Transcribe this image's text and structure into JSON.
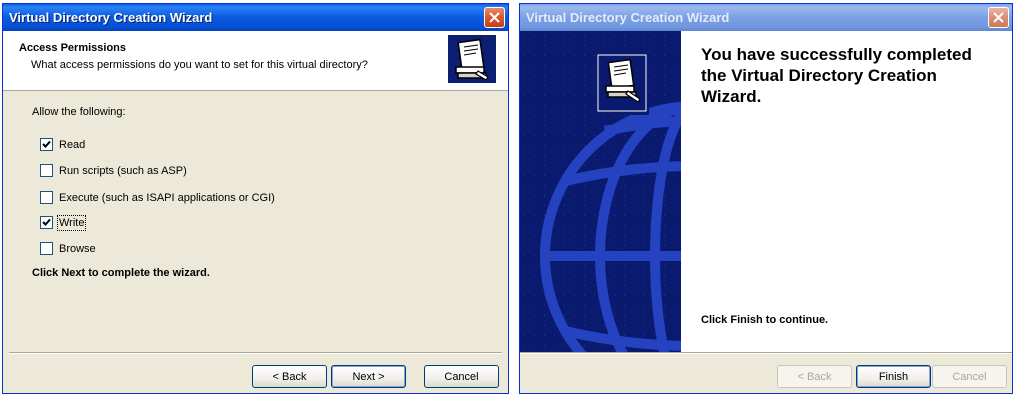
{
  "left_window": {
    "title": "Virtual Directory Creation Wizard",
    "header": {
      "title": "Access Permissions",
      "subtitle": "What access permissions do you want to set for this virtual directory?"
    },
    "prompt": "Allow the following:",
    "permissions": [
      {
        "label": "Read",
        "checked": true
      },
      {
        "label": "Run scripts (such as ASP)",
        "checked": false
      },
      {
        "label": "Execute (such as ISAPI applications or CGI)",
        "checked": false
      },
      {
        "label": "Write",
        "checked": true
      },
      {
        "label": "Browse",
        "checked": false
      }
    ],
    "instruction": "Click Next to complete the wizard.",
    "buttons": {
      "back": "< Back",
      "next": "Next >",
      "cancel": "Cancel"
    }
  },
  "right_window": {
    "title": "Virtual Directory Creation Wizard",
    "heading": "You have successfully completed the Virtual Directory Creation Wizard.",
    "note": "Click Finish to continue.",
    "buttons": {
      "back": "< Back",
      "finish": "Finish",
      "cancel": "Cancel"
    }
  },
  "colors": {
    "titlebar_active": "#0a5ae0",
    "titlebar_inactive": "#7ca0e4",
    "dialog_face": "#ece9d8",
    "sidebar": "#0a1a6e"
  },
  "icons": [
    "close-icon",
    "book-wizard-icon",
    "globe-icon",
    "checkmark-icon"
  ]
}
